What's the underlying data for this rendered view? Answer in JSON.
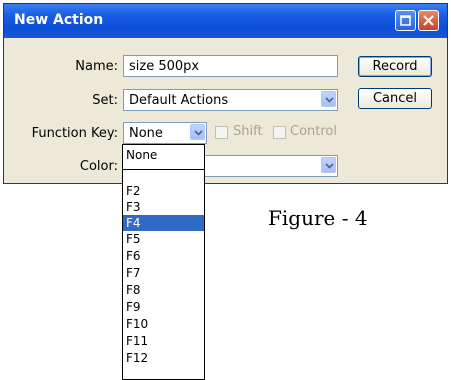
{
  "window": {
    "title": "New Action"
  },
  "form": {
    "name_label": "Name:",
    "name_value": "size 500px",
    "set_label": "Set:",
    "set_value": "Default Actions",
    "function_key_label": "Function Key:",
    "function_key_value": "None",
    "shift_label": "Shift",
    "control_label": "Control",
    "color_label": "Color:"
  },
  "buttons": {
    "record": "Record",
    "cancel": "Cancel"
  },
  "function_key_options": [
    "None",
    "F2",
    "F3",
    "F4",
    "F5",
    "F6",
    "F7",
    "F8",
    "F9",
    "F10",
    "F11",
    "F12"
  ],
  "selected_option": "F4",
  "caption": "Figure - 4",
  "colors": {
    "titlebar": "#0a4fd6",
    "selection": "#316ac5",
    "dialog_bg": "#ece9d8"
  },
  "icons": [
    "restore-icon",
    "close-icon",
    "chevron-down-icon"
  ]
}
